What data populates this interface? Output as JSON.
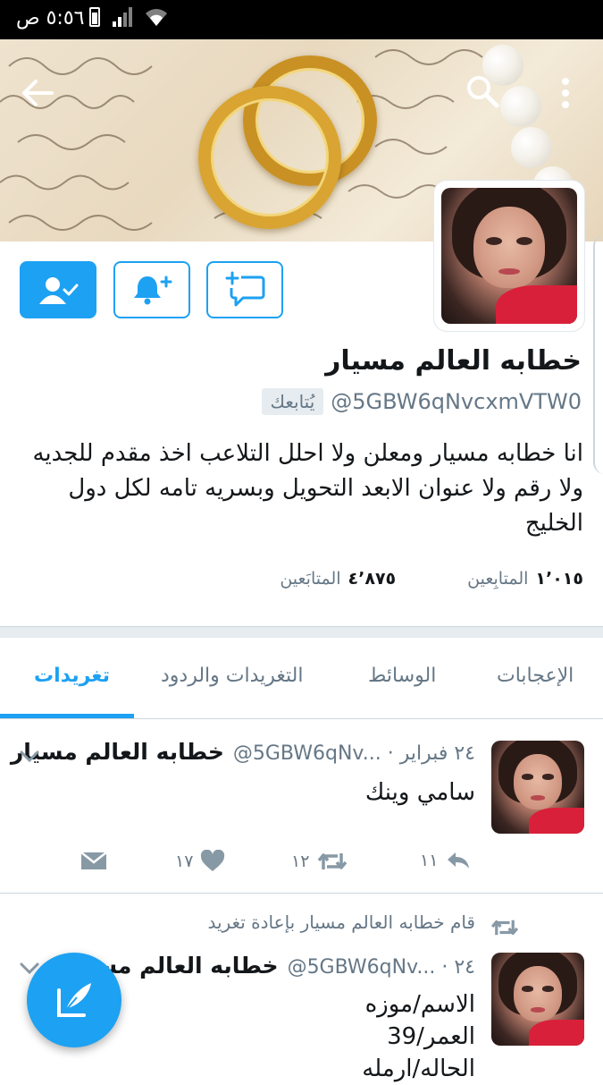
{
  "status_bar": {
    "time": "٥:٥٦ ص"
  },
  "profile": {
    "name": "خطابه العالم مسيار",
    "handle": "@5GBW6qNvcxmVTW0",
    "follows_you": "يُتابعك",
    "bio": "انا خطابه مسيار ومعلن ولا احلل التلاعب اخذ مقدم للجديه ولا رقم ولا عنوان الابعد التحويل وبسريه تامه لكل دول الخليج",
    "followers_count": "٤٬٨٧٥",
    "followers_label": "المتابَعين",
    "following_count": "١٬٠١٥",
    "following_label": "المتابِعين"
  },
  "tabs": {
    "tweets": "تغريدات",
    "tweets_replies": "التغريدات والردود",
    "media": "الوسائط",
    "likes": "الإعجابات"
  },
  "tweets": [
    {
      "name": "خطابه العالم مسيار",
      "meta": "@5GBW6qNv... · ٢٤ فبراير",
      "text": "سامي وينك",
      "replies": "١١",
      "retweets": "١٢",
      "likes": "١٧"
    },
    {
      "retweeted_by": "قام خطابه العالم مسيار بإعادة تغريد",
      "name": "خطابه العالم مسيار",
      "meta": "@5GBW6qNv... · ٢٤",
      "text_lines": [
        "الاسم/موزه",
        "العمر/39",
        "الحاله/ارمله"
      ]
    }
  ],
  "colors": {
    "accent": "#1da1f2",
    "muted": "#657786",
    "divider": "#e6ecf0"
  }
}
